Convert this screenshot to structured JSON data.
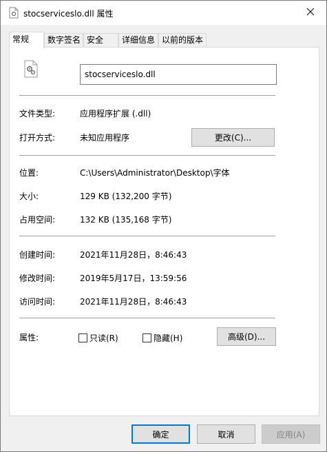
{
  "window": {
    "title": "stocserviceslo.dll 属性"
  },
  "tabs": [
    {
      "label": "常规",
      "active": true
    },
    {
      "label": "数字签名",
      "active": false
    },
    {
      "label": "安全",
      "active": false
    },
    {
      "label": "详细信息",
      "active": false
    },
    {
      "label": "以前的版本",
      "active": false
    }
  ],
  "general": {
    "file_name": "stocserviceslo.dll",
    "file_type_label": "文件类型:",
    "file_type_value": "应用程序扩展 (.dll)",
    "open_with_label": "打开方式:",
    "open_with_value": "未知应用程序",
    "change_button": "更改(C)...",
    "location_label": "位置:",
    "location_value": "C:\\Users\\Administrator\\Desktop\\字体",
    "size_label": "大小:",
    "size_value": "129 KB (132,200 字节)",
    "size_on_disk_label": "占用空间:",
    "size_on_disk_value": "132 KB (135,168 字节)",
    "created_label": "创建时间:",
    "created_value": "2021年11月28日，8:46:43",
    "modified_label": "修改时间:",
    "modified_value": "2019年5月17日，13:59:56",
    "accessed_label": "访问时间:",
    "accessed_value": "2021年11月28日，8:46:43",
    "attributes_label": "属性:",
    "readonly_label": "只读(R)",
    "hidden_label": "隐藏(H)",
    "advanced_button": "高级(D)..."
  },
  "footer": {
    "ok": "确定",
    "cancel": "取消",
    "apply": "应用(A)"
  },
  "icons": {
    "title": "dll-file-icon",
    "file": "dll-gear-file-icon",
    "close": "close-icon"
  },
  "colors": {
    "accent": "#0078d7",
    "window_bg": "#f0f0f0",
    "panel_bg": "#ffffff"
  }
}
